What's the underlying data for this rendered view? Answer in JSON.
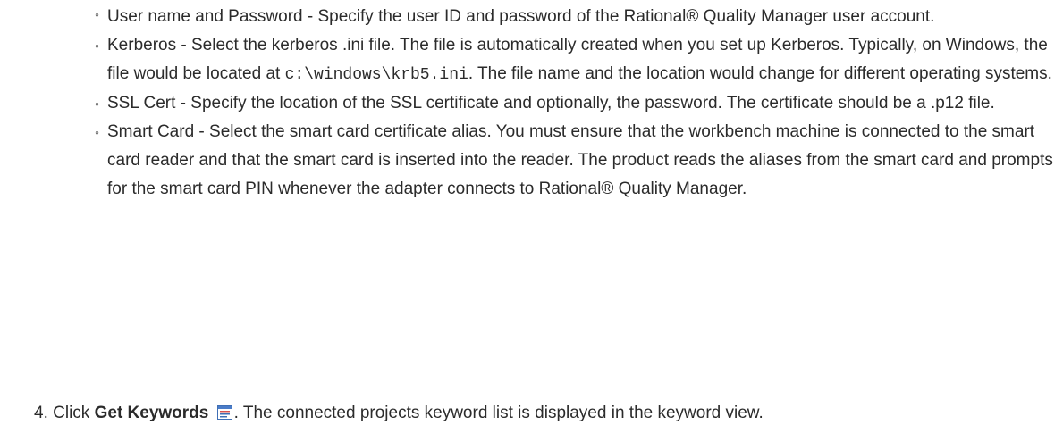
{
  "auth_options": [
    {
      "bullet": "◦",
      "text": "User name and Password - Specify the user ID and password of the  Rational® Quality Manager user account."
    },
    {
      "bullet": "◦",
      "text_before": "Kerberos - Select the kerberos .ini file. The file is automatically created when you set up Kerberos. Typically, on Windows, the file would be located at ",
      "code": "c:\\windows\\krb5.ini",
      "text_after": ". The file name and the location would change for different operating systems."
    },
    {
      "bullet": "◦",
      "text": "SSL Cert - Specify the location of the SSL certificate and optionally, the password. The certificate should be a .p12 file."
    },
    {
      "bullet": "◦",
      "text": "Smart Card - Select the smart card certificate alias. You must ensure that the workbench machine is connected to the smart card reader and that the smart card is inserted into the reader. The product reads the aliases from the smart card and prompts for the smart card PIN whenever the adapter connects to  Rational® Quality Manager."
    }
  ],
  "step4": {
    "number": "4.",
    "prefix": "Click ",
    "action": "Get Keywords",
    "icon": "get-keywords-icon",
    "suffix": ". The connected projects keyword list is displayed in the keyword view."
  }
}
